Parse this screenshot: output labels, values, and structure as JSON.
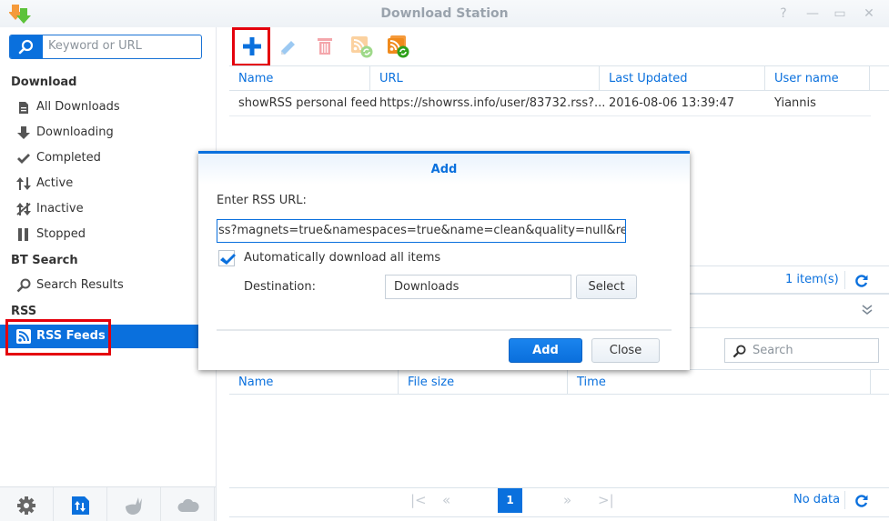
{
  "window": {
    "title": "Download Station",
    "controls": [
      "help-icon",
      "minimize-icon",
      "maximize-icon",
      "close-icon"
    ]
  },
  "sidebar": {
    "search_placeholder": "Keyword or URL",
    "sections": [
      {
        "label": "Download",
        "items": [
          {
            "label": "All Downloads",
            "icon": "all-downloads-icon"
          },
          {
            "label": "Downloading",
            "icon": "download-arrow-icon"
          },
          {
            "label": "Completed",
            "icon": "checkmark-icon"
          },
          {
            "label": "Active",
            "icon": "up-down-arrows-icon"
          },
          {
            "label": "Inactive",
            "icon": "inactive-arrows-icon"
          },
          {
            "label": "Stopped",
            "icon": "pause-icon"
          }
        ]
      },
      {
        "label": "BT Search",
        "items": [
          {
            "label": "Search Results",
            "icon": "search-icon"
          }
        ]
      },
      {
        "label": "RSS",
        "items": [
          {
            "label": "RSS Feeds",
            "icon": "rss-icon",
            "active": true
          }
        ]
      }
    ],
    "bottom_buttons": [
      "settings-gear-icon",
      "transfer-file-icon",
      "emule-donkey-icon",
      "cloud-icon"
    ]
  },
  "toolbar": {
    "buttons": [
      "add-icon",
      "edit-pencil-icon",
      "delete-trash-icon",
      "rss-refresh-icon",
      "rss-refresh-all-icon"
    ]
  },
  "feeds_grid": {
    "columns": [
      "Name",
      "URL",
      "Last Updated",
      "User name"
    ],
    "rows": [
      {
        "name": "showRSS personal feed",
        "url": "https://showrss.info/user/83732.rss?...",
        "last_updated": "2016-08-06 13:39:47",
        "user": "Yiannis"
      }
    ],
    "count_label": "1 item(s)"
  },
  "items_grid": {
    "search_placeholder": "Search",
    "columns": [
      "Name",
      "File size",
      "Time"
    ],
    "pager": {
      "current_page": "1",
      "status": "No data"
    }
  },
  "dialog": {
    "title": "Add",
    "url_label": "Enter RSS URL:",
    "url_value": "ss?magnets=true&namespaces=true&name=clean&quality=null&re=null",
    "auto_download_label": "Automatically download all items",
    "auto_download_checked": true,
    "destination_label": "Destination:",
    "destination_value": "Downloads",
    "select_label": "Select",
    "add_label": "Add",
    "close_label": "Close"
  },
  "colors": {
    "accent": "#0a70dd",
    "highlight": "#e4000c"
  }
}
